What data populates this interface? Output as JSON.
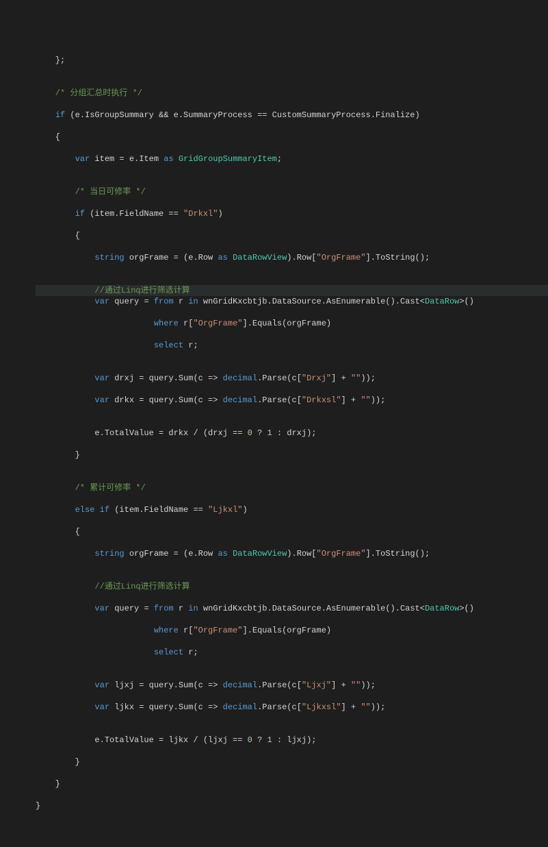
{
  "code": {
    "l01": "    };",
    "l02": "",
    "l03_cm": "    /* 分组汇总时执行 */",
    "l04": {
      "kw": "if",
      "txt": " (e.IsGroupSummary && e.SummaryProcess == CustomSummaryProcess.Finalize)"
    },
    "l05": "    {",
    "l06": {
      "kw": "var",
      "txt1": " item = e.Item ",
      "kw2": "as",
      "tp": " GridGroupSummaryItem",
      "txt2": ";"
    },
    "l07": "",
    "l08_cm": "        /* 当日可修率 */",
    "l09": {
      "kw": "if",
      "txt1": " (item.FieldName == ",
      "st": "\"Drkxl\"",
      "txt2": ")"
    },
    "l10": "        {",
    "l11": {
      "kw": "string",
      "txt1": " orgFrame = (e.Row ",
      "kw2": "as",
      "tp": " DataRowView",
      "txt2": ").Row[",
      "st": "\"OrgFrame\"",
      "txt3": "].ToString();"
    },
    "l12": "",
    "l13_cm": "            //通过Linq进行筛选计算",
    "l14": {
      "kw": "var",
      "txt1": " query = ",
      "kw2": "from",
      "txt2": " r ",
      "kw3": "in",
      "txt3": " wnGridKxcbtjb.DataSource.AsEnumerable().Cast<",
      "tp": "DataRow",
      "txt4": ">()"
    },
    "l15": {
      "kw": "where",
      "txt1": " r[",
      "st": "\"OrgFrame\"",
      "txt2": "].Equals(orgFrame)"
    },
    "l16": {
      "kw": "select",
      "txt": " r;"
    },
    "l17": "",
    "l18": {
      "kw": "var",
      "txt1": " drxj = query.Sum(c => ",
      "kw2": "decimal",
      "txt2": ".Parse(c[",
      "st1": "\"Drxj\"",
      "txt3": "] + ",
      "st2": "\"\"",
      "txt4": "));"
    },
    "l19": {
      "kw": "var",
      "txt1": " drkx = query.Sum(c => ",
      "kw2": "decimal",
      "txt2": ".Parse(c[",
      "st1": "\"Drkxsl\"",
      "txt3": "] + ",
      "st2": "\"\"",
      "txt4": "));"
    },
    "l20": "",
    "l21": {
      "txt1": "            e.TotalValue = drkx / (drxj == ",
      "n1": "0",
      "txt2": " ? ",
      "n2": "1",
      "txt3": " : drxj);"
    },
    "l22": "        }",
    "l23": "",
    "l24_cm": "        /* 累计可修率 */",
    "l25": {
      "kw1": "else",
      "kw2": "if",
      "txt1": " (item.FieldName == ",
      "st": "\"Ljkxl\"",
      "txt2": ")"
    },
    "l26": "        {",
    "l27": {
      "kw": "string",
      "txt1": " orgFrame = (e.Row ",
      "kw2": "as",
      "tp": " DataRowView",
      "txt2": ").Row[",
      "st": "\"OrgFrame\"",
      "txt3": "].ToString();"
    },
    "l28": "",
    "l29_cm": "            //通过Linq进行筛选计算",
    "l30": {
      "kw": "var",
      "txt1": " query = ",
      "kw2": "from",
      "txt2": " r ",
      "kw3": "in",
      "txt3": " wnGridKxcbtjb.DataSource.AsEnumerable().Cast<",
      "tp": "DataRow",
      "txt4": ">()"
    },
    "l31": {
      "kw": "where",
      "txt1": " r[",
      "st": "\"OrgFrame\"",
      "txt2": "].Equals(orgFrame)"
    },
    "l32": {
      "kw": "select",
      "txt": " r;"
    },
    "l33": "",
    "l34": {
      "kw": "var",
      "txt1": " ljxj = query.Sum(c => ",
      "kw2": "decimal",
      "txt2": ".Parse(c[",
      "st1": "\"Ljxj\"",
      "txt3": "] + ",
      "st2": "\"\"",
      "txt4": "));"
    },
    "l35": {
      "kw": "var",
      "txt1": " ljkx = query.Sum(c => ",
      "kw2": "decimal",
      "txt2": ".Parse(c[",
      "st1": "\"Ljkxsl\"",
      "txt3": "] + ",
      "st2": "\"\"",
      "txt4": "));"
    },
    "l36": "",
    "l37": {
      "txt1": "            e.TotalValue = ljkx / (ljxj == ",
      "n1": "0",
      "txt2": " ? ",
      "n2": "1",
      "txt3": " : ljxj);"
    },
    "l38": "        }",
    "l39": "    }",
    "l40": "}"
  }
}
